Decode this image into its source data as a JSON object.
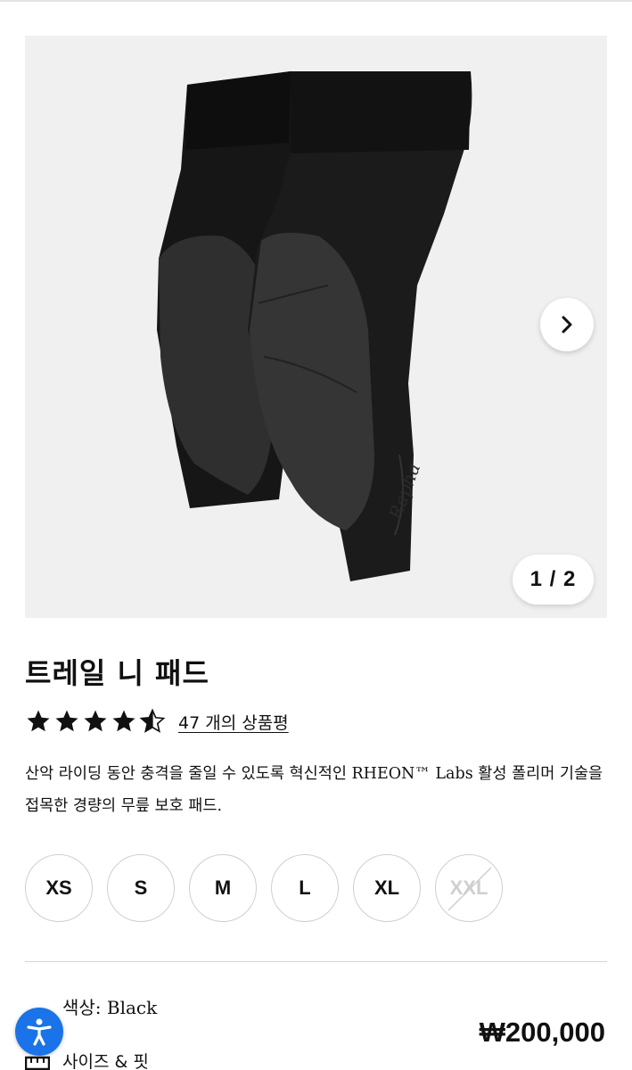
{
  "product": {
    "title": "트레일 니 패드",
    "rating": 4.5,
    "reviews_link": "47 개의 상품평",
    "description": "산악 라이딩 동안 충격을 줄일 수 있도록 혁신적인 RHEON™ Labs 활성 폴리머 기술을 접목한 경량의 무릎 보호 패드.",
    "image_brand_mark": "Rapha",
    "color_line": "색상: Black",
    "price": "₩200,000",
    "size_fit_label": "사이즈 & 핏"
  },
  "gallery": {
    "counter": "1 / 2",
    "next_icon": "chevron-right-icon"
  },
  "sizes": [
    {
      "label": "XS",
      "available": true
    },
    {
      "label": "S",
      "available": true
    },
    {
      "label": "M",
      "available": true
    },
    {
      "label": "L",
      "available": true
    },
    {
      "label": "XL",
      "available": true
    },
    {
      "label": "XXL",
      "available": false
    }
  ],
  "colors": {
    "accessibility_button": "#1a73e8",
    "text": "#111111",
    "disabled": "#cfcfcf"
  }
}
